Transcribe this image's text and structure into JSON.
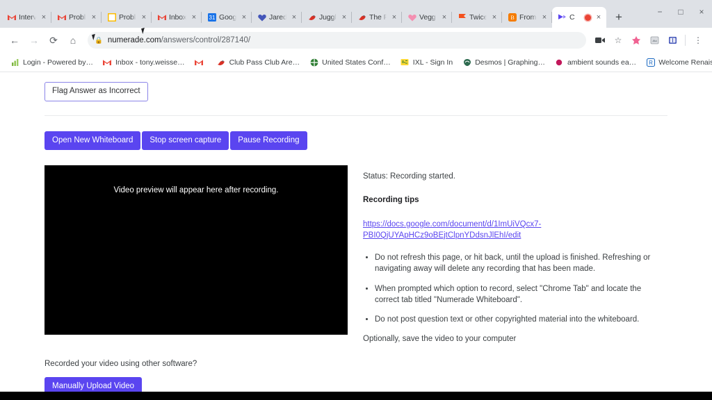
{
  "browser": {
    "tabs": [
      {
        "title": "Interv",
        "icon": "gmail-icon",
        "active": false
      },
      {
        "title": "Probl",
        "icon": "gmail-icon",
        "active": false
      },
      {
        "title": "Probl",
        "icon": "keep-icon",
        "active": false
      },
      {
        "title": "Inbox",
        "icon": "gmail-icon",
        "active": false
      },
      {
        "title": "Goog",
        "icon": "calendar-icon",
        "active": false
      },
      {
        "title": "Jared",
        "icon": "heart-icon",
        "active": false
      },
      {
        "title": "Juggl",
        "icon": "red-bird-icon",
        "active": false
      },
      {
        "title": "The F",
        "icon": "red-bird-icon",
        "active": false
      },
      {
        "title": "Vegg",
        "icon": "pink-heart-icon",
        "active": false
      },
      {
        "title": "Twice",
        "icon": "orange-flag-icon",
        "active": false
      },
      {
        "title": "From",
        "icon": "blogger-icon",
        "active": false
      },
      {
        "title": "C",
        "icon": "numerade-icon",
        "active": true,
        "recording": true
      }
    ],
    "new_tab_label": "+",
    "close_label": "×",
    "window_controls": {
      "minimize": "−",
      "maximize": "□",
      "close": "×"
    },
    "nav": {
      "back": "←",
      "forward": "→",
      "reload": "⟳",
      "home": "⌂"
    },
    "omnibox": {
      "lock_icon": "lock-icon",
      "domain": "numerade.com",
      "path": "/answers/control/287140/"
    },
    "toolbar_icons": [
      {
        "name": "screen-share-icon",
        "glyph": "■"
      },
      {
        "name": "bookmark-star-icon",
        "glyph": "☆"
      },
      {
        "name": "extension-pink-icon",
        "glyph": "✦"
      },
      {
        "name": "extension-gray-icon",
        "glyph": "▣"
      },
      {
        "name": "extension-blue-icon",
        "glyph": "▤"
      },
      {
        "name": "chrome-menu-icon",
        "glyph": "⋮"
      }
    ],
    "bookmarks": [
      {
        "label": "Login - Powered by…",
        "icon": "chart-icon"
      },
      {
        "label": "Inbox - tony.weisse…",
        "icon": "gmail-icon"
      },
      {
        "label": "",
        "icon": "gmail-icon"
      },
      {
        "label": "Club Pass Club Are…",
        "icon": "red-bird-icon"
      },
      {
        "label": "United States Conf…",
        "icon": "globe-icon"
      },
      {
        "label": "IXL - Sign In",
        "icon": "ixl-icon"
      },
      {
        "label": "Desmos | Graphing…",
        "icon": "desmos-icon"
      },
      {
        "label": "ambient sounds ea…",
        "icon": "dot-icon"
      },
      {
        "label": "Welcome Renaissa…",
        "icon": "renaissance-icon"
      }
    ],
    "bookmarks_overflow": "»"
  },
  "page": {
    "flag_button": "Flag Answer as Incorrect",
    "action_buttons": [
      "Open New Whiteboard",
      "Stop screen capture",
      "Pause Recording"
    ],
    "video_placeholder": "Video preview will appear here after recording.",
    "status": "Status: Recording started.",
    "tips_heading": "Recording tips",
    "tips_link": "https://docs.google.com/document/d/1ImUiVQcx7-PBI0QjUYApHCz9oBEjtClpnYDdsnJlEhI/edit",
    "tips": [
      "Do not refresh this page, or hit back, until the upload is finished. Refreshing or navigating away will delete any recording that has been made.",
      "When prompted which option to record, select \"Chrome Tab\" and locate the correct tab titled \"Numerade Whiteboard\".",
      "Do not post question text or other copyrighted material into the whiteboard."
    ],
    "optional_note": "Optionally, save the video to your computer",
    "other_software_question": "Recorded your video using other software?",
    "upload_button": "Manually Upload Video"
  },
  "colors": {
    "accent_purple": "#5a45f0",
    "record_red": "#ea4335",
    "tabstrip_bg": "#dee1e6"
  }
}
